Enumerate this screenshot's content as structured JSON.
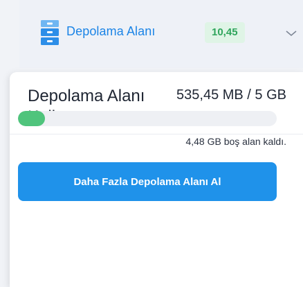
{
  "topbar": {
    "label": "Depolama Alanı",
    "badge": "10,45",
    "icon": "storage-drawer-icon",
    "chevron_icon": "chevron-down-icon"
  },
  "panel": {
    "title": "Depolama Alanı Kullanımı",
    "usage": "535,45 MB / 5 GB",
    "usage_fraction": 0.105,
    "free": "4,48 GB boş alan kaldı.",
    "button": "Daha Fazla Depolama Alanı Al"
  },
  "colors": {
    "accent": "#1f92ea",
    "label_blue": "#1b84e6",
    "progress": "#4fc47c",
    "badge_bg": "#dff4e6",
    "badge_text": "#2fa55c"
  }
}
